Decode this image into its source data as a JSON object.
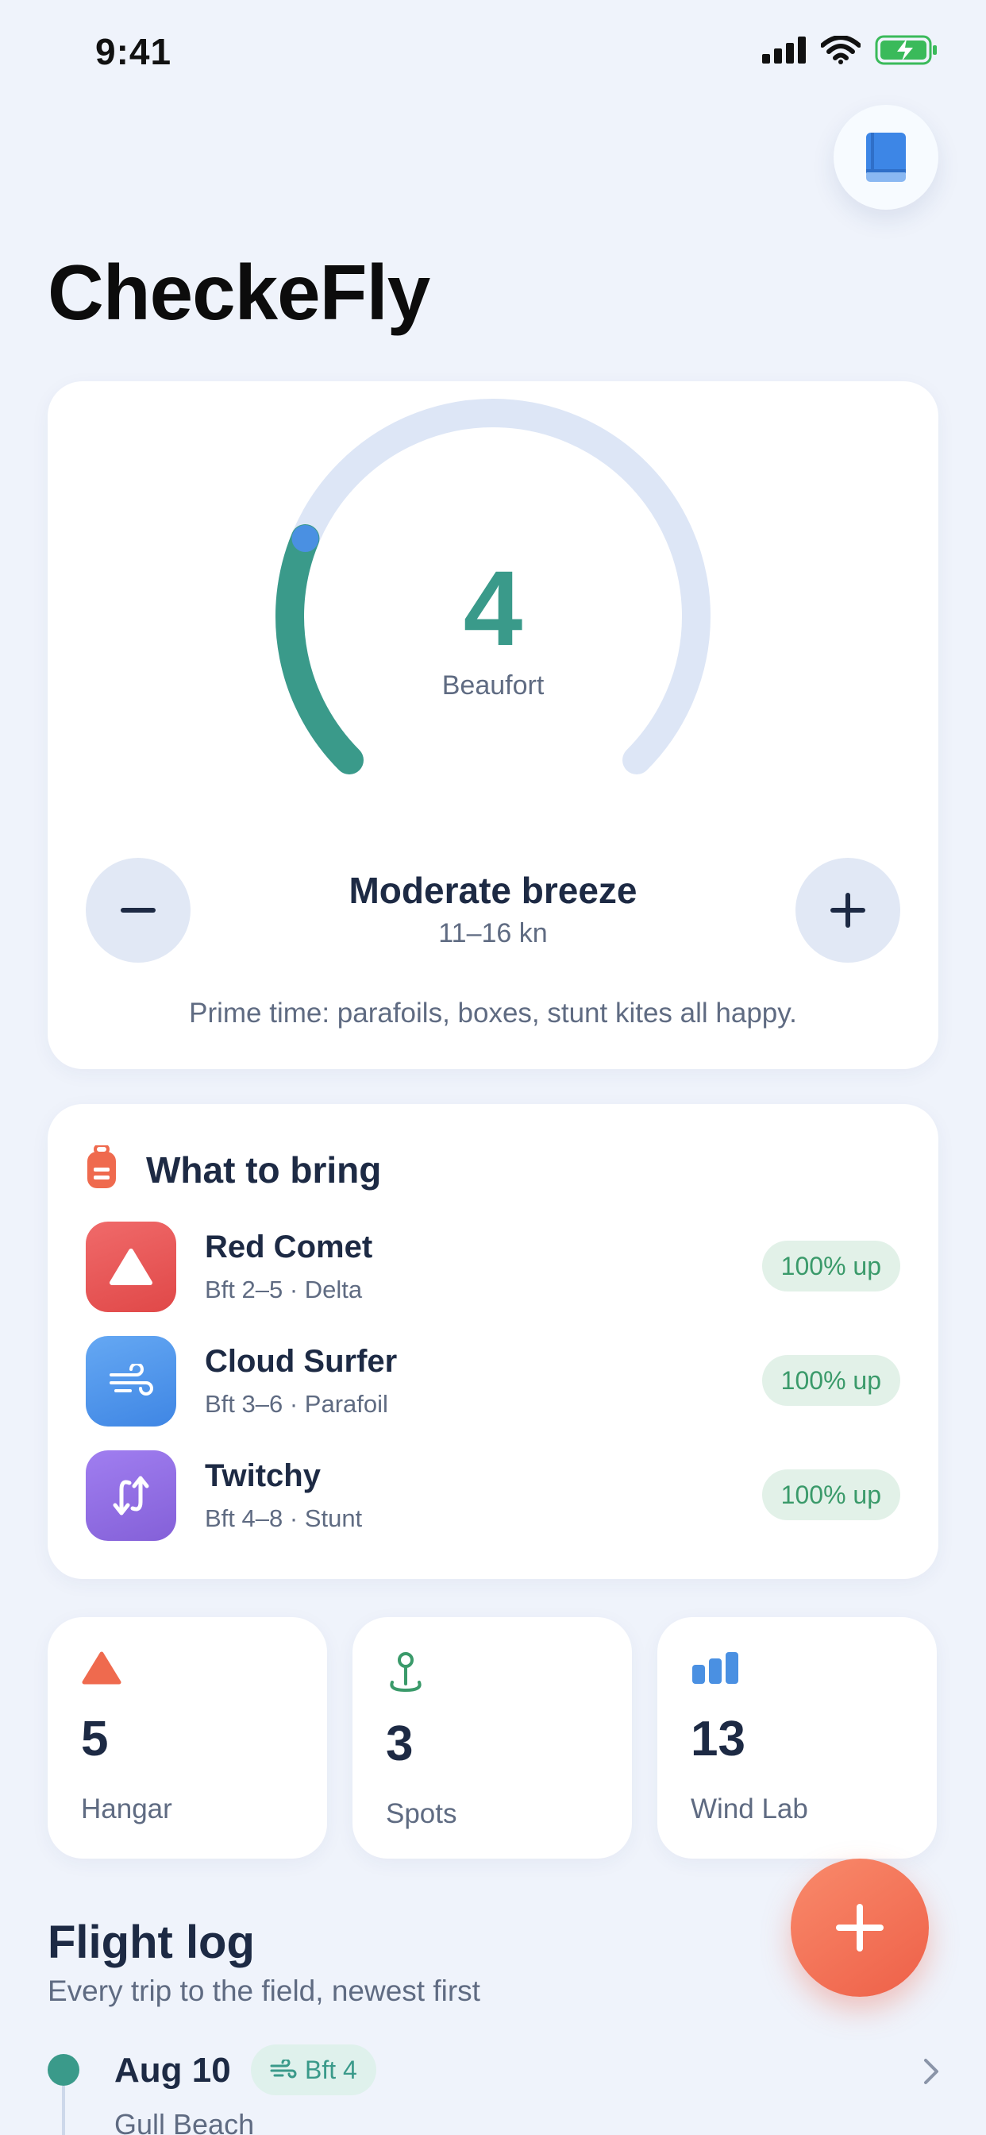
{
  "status_bar": {
    "time": "9:41"
  },
  "app": {
    "title": "CheckeFly"
  },
  "gauge": {
    "value": "4",
    "unit": "Beaufort",
    "level_fraction": 0.25,
    "name": "Moderate breeze",
    "range": "11–16 kn",
    "note": "Prime time: parafoils, boxes, stunt kites all happy."
  },
  "bring": {
    "title": "What to bring",
    "items": [
      {
        "name": "Red Comet",
        "meta": "Bft 2–5 · Delta",
        "badge": "100% up",
        "color": "#ea5454",
        "icon": "delta-kite-icon"
      },
      {
        "name": "Cloud Surfer",
        "meta": "Bft 3–6 · Parafoil",
        "badge": "100% up",
        "color": "#4d95ec",
        "icon": "wind-icon"
      },
      {
        "name": "Twitchy",
        "meta": "Bft 4–8 · Stunt",
        "badge": "100% up",
        "color": "#8f6ee0",
        "icon": "stunt-lines-icon"
      }
    ]
  },
  "stats": [
    {
      "value": "5",
      "label": "Hangar",
      "icon": "triangle-icon"
    },
    {
      "value": "3",
      "label": "Spots",
      "icon": "pin-icon"
    },
    {
      "value": "13",
      "label": "Wind Lab",
      "icon": "bars-icon"
    }
  ],
  "log": {
    "title": "Flight log",
    "subtitle": "Every trip to the field, newest first",
    "entries": [
      {
        "date": "Aug 10",
        "badge": "Bft 4",
        "place": "Gull Beach"
      }
    ]
  },
  "colors": {
    "accent": "#3a9a8a",
    "fab": "#ef6a4e",
    "track": "#dde6f6"
  }
}
